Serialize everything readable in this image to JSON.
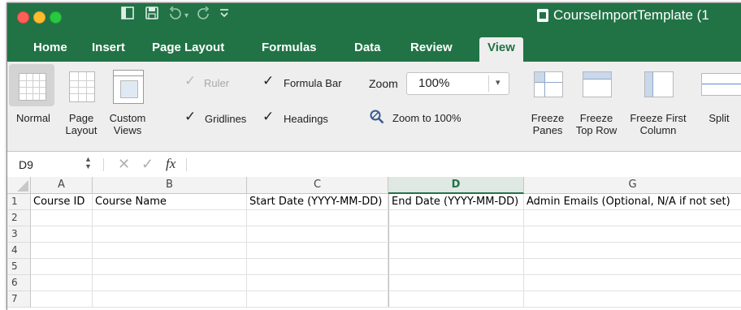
{
  "window": {
    "title": "CourseImportTemplate (1"
  },
  "quick_access": {
    "icons": [
      "toggle-ribbon-icon",
      "save-icon",
      "undo-icon",
      "undo-dropdown-icon",
      "redo-icon",
      "customize-dropdown-icon"
    ]
  },
  "tabs": [
    {
      "label": "Home"
    },
    {
      "label": "Insert"
    },
    {
      "label": "Page Layout"
    },
    {
      "label": "Formulas"
    },
    {
      "label": "Data"
    },
    {
      "label": "Review"
    },
    {
      "label": "View",
      "active": true
    }
  ],
  "ribbon": {
    "normal": "Normal",
    "page_layout_1": "Page",
    "page_layout_2": "Layout",
    "custom_views_1": "Custom",
    "custom_views_2": "Views",
    "ruler": "Ruler",
    "formula_bar": "Formula Bar",
    "gridlines": "Gridlines",
    "headings": "Headings",
    "zoom_label": "Zoom",
    "zoom_value": "100%",
    "zoom_to_100": "Zoom to 100%",
    "freeze_panes_1": "Freeze",
    "freeze_panes_2": "Panes",
    "freeze_top_row_1": "Freeze",
    "freeze_top_row_2": "Top Row",
    "freeze_first_col_1": "Freeze First",
    "freeze_first_col_2": "Column",
    "split": "Split"
  },
  "formula_bar": {
    "name_box": "D9",
    "fx": "fx"
  },
  "sheet": {
    "columns": [
      "A",
      "B",
      "C",
      "D",
      "G"
    ],
    "selected_column": "D",
    "rows": [
      "1",
      "2",
      "3",
      "4",
      "5",
      "6",
      "7"
    ],
    "row1": [
      "Course ID",
      "Course Name",
      "Start Date (YYYY-MM-DD)",
      "End Date (YYYY-MM-DD)",
      "Admin Emails (Optional, N/A if not set)"
    ]
  },
  "colors": {
    "brand": "#217346",
    "ribbon_bg": "#eeeeee"
  }
}
